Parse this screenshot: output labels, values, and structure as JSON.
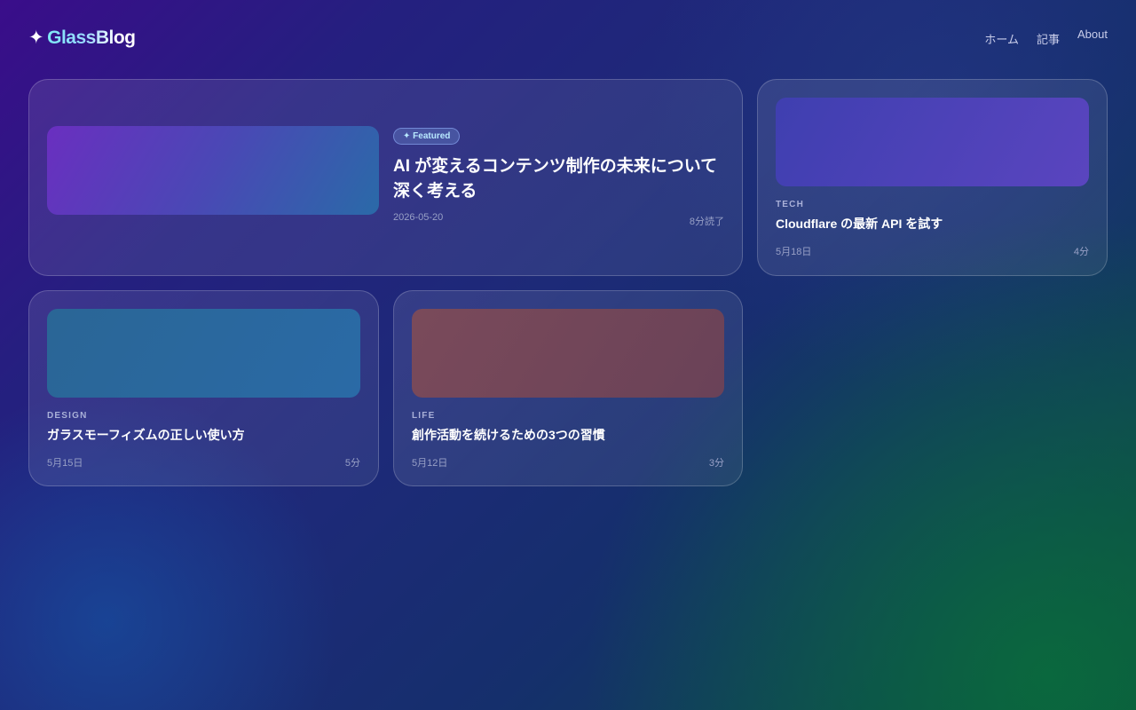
{
  "brand": {
    "star": "✦",
    "name": "GlassBlog"
  },
  "nav": {
    "items": [
      "ホーム",
      "記事",
      "About"
    ]
  },
  "featured": {
    "badge": "✦ Featured",
    "title": "AI が変えるコンテンツ制作の未来について深く考える",
    "date": "2026-05-20",
    "read_time": "8分読了"
  },
  "posts": [
    {
      "category": "TECH",
      "title": "Cloudflare の最新 API を試す",
      "date": "5月18日",
      "read_time": "4分"
    },
    {
      "category": "DESIGN",
      "title": "ガラスモーフィズムの正しい使い方",
      "date": "5月15日",
      "read_time": "5分"
    },
    {
      "category": "LIFE",
      "title": "創作活動を続けるための3つの習慣",
      "date": "5月12日",
      "read_time": "3分"
    }
  ],
  "colors": {
    "bg_start": "#3a0d8a",
    "bg_end": "#0c4a3e",
    "accent": "#7ee8f5",
    "thumb_featured": [
      "#6a2fc0",
      "#2a6aa8"
    ],
    "thumb_tech": [
      "#3f3fb0",
      "#5a45bf"
    ],
    "thumb_design": [
      "#2a6696",
      "#2a6aa6"
    ],
    "thumb_life": [
      "#7a4a5a",
      "#6a4258"
    ]
  }
}
